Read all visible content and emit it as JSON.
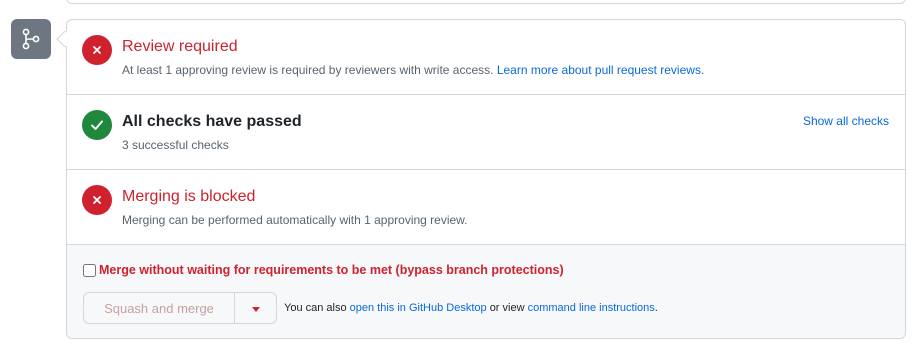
{
  "checks": [
    {
      "title": "Review required",
      "description": "At least 1 approving review is required by reviewers with write access.",
      "link": "Learn more about pull request reviews.",
      "status": "failed"
    },
    {
      "title": "All checks have passed",
      "description": "3 successful checks",
      "action": "Show all checks",
      "status": "passed"
    },
    {
      "title": "Merging is blocked",
      "description": "Merging can be performed automatically with 1 approving review.",
      "status": "failed"
    }
  ],
  "merge": {
    "bypass_label": "Merge without waiting for requirements to be met (bypass branch protections)",
    "bypass_checked": false,
    "button_label": "Squash and merge",
    "alt_prefix": "You can also",
    "desktop_link": "open this in GitHub Desktop",
    "alt_middle": "or view",
    "cli_link": "command line instructions",
    "alt_suffix": "."
  },
  "icons": {
    "badge": "git-branch-icon",
    "fail": "x-icon",
    "pass": "check-icon",
    "dropdown": "triangle-down-icon"
  },
  "colors": {
    "danger": "#cf222e",
    "success": "#1f883d",
    "link": "#0969da",
    "muted": "#59636e"
  }
}
